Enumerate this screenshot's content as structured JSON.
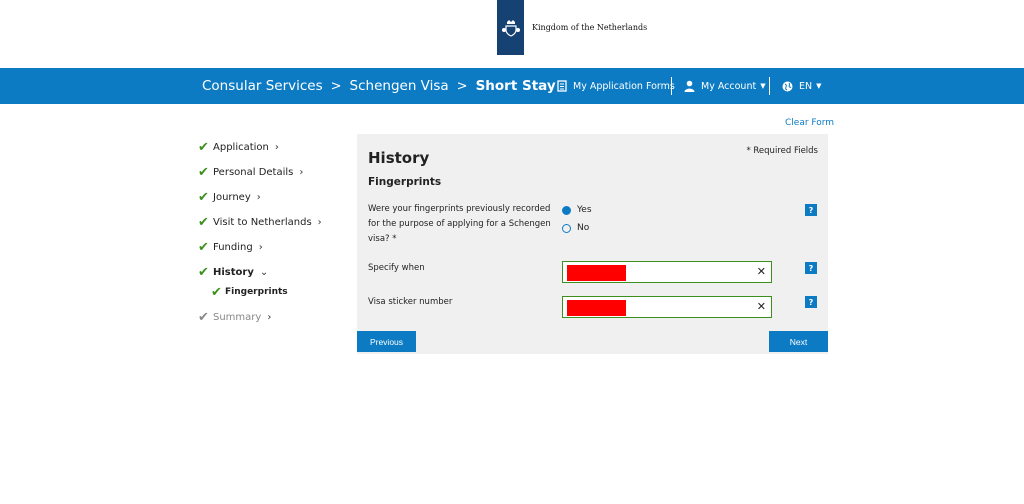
{
  "header": {
    "org_name": "Kingdom of the Netherlands",
    "logo_icon": "royal-crest-icon"
  },
  "nav": {
    "breadcrumbs": [
      {
        "label": "Consular Services"
      },
      {
        "label": "Schengen Visa"
      },
      {
        "label": "Short Stay"
      }
    ],
    "breadcrumb_separator": ">",
    "app_forms": "My Application Forms",
    "account": "My Account",
    "language": "EN",
    "bg_color": "#0c7bc4"
  },
  "sidebar": {
    "steps": [
      {
        "label": "Application"
      },
      {
        "label": "Personal Details"
      },
      {
        "label": "Journey"
      },
      {
        "label": "Visit to Netherlands"
      },
      {
        "label": "Funding"
      },
      {
        "label": "History"
      }
    ],
    "substep": "Fingerprints",
    "pending": "Summary"
  },
  "form": {
    "clear": "Clear Form",
    "title": "History",
    "required_note": "* Required Fields",
    "section": "Fingerprints",
    "question_lines": [
      "Were your fingerprints previously recorded",
      "for the purpose of applying for a Schengen",
      "visa? *"
    ],
    "options": [
      {
        "label": "Yes",
        "selected": true
      },
      {
        "label": "No",
        "selected": false
      }
    ],
    "specify_when": "Specify when",
    "sticker_number": "Visa sticker number",
    "clear_symbol": "✕",
    "help_symbol": "?",
    "previous": "Previous",
    "next": "Next"
  },
  "colors": {
    "accent": "#0c7bc4",
    "valid": "#3b8f1c",
    "panel": "#f0f0f0"
  }
}
